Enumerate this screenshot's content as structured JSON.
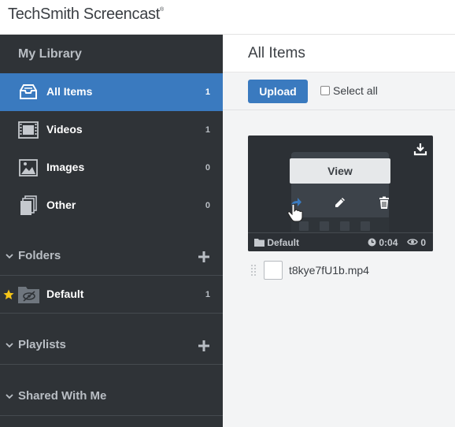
{
  "app": {
    "brand": "TechSmith Screencast",
    "brand_mark": "®"
  },
  "sidebar": {
    "library_title": "My Library",
    "items": [
      {
        "label": "All Items",
        "count": "1",
        "icon": "inbox-tray-icon",
        "active": true
      },
      {
        "label": "Videos",
        "count": "1",
        "icon": "film-strip-icon",
        "active": false
      },
      {
        "label": "Images",
        "count": "0",
        "icon": "image-icon",
        "active": false
      },
      {
        "label": "Other",
        "count": "0",
        "icon": "stacked-pages-icon",
        "active": false
      }
    ],
    "folders_title": "Folders",
    "folders": [
      {
        "label": "Default",
        "count": "1",
        "starred": true
      }
    ],
    "playlists_title": "Playlists",
    "shared_title": "Shared With Me"
  },
  "main": {
    "title": "All Items",
    "toolbar": {
      "upload_label": "Upload",
      "select_all_label": "Select all"
    },
    "media": {
      "view_label": "View",
      "folder": "Default",
      "duration": "0:04",
      "views": "0",
      "filename": "t8kye7fU1b.mp4"
    }
  },
  "colors": {
    "sidebar_bg": "#2f3337",
    "accent": "#3a7abf",
    "star": "#f5c518",
    "main_bg": "#f3f4f5"
  }
}
